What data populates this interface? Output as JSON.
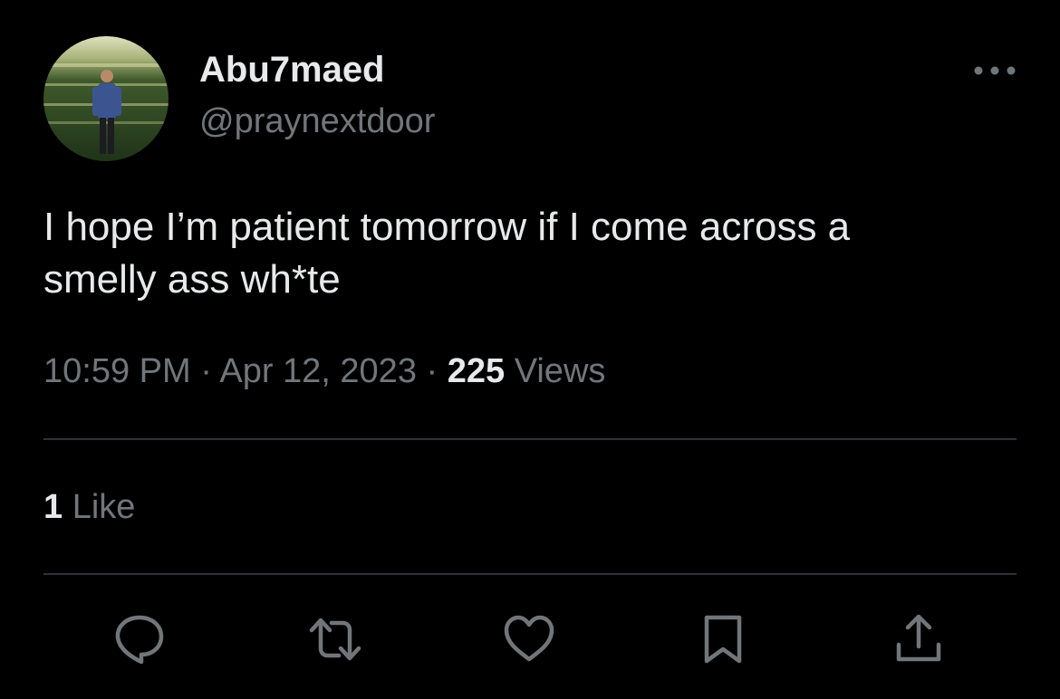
{
  "author": {
    "display_name": "Abu7maed",
    "handle": "@praynextdoor"
  },
  "tweet": {
    "text": "I hope I’m patient tomorrow if I come across a\nsmelly ass wh*te",
    "time": "10:59 PM",
    "separator": "·",
    "date": "Apr 12, 2023",
    "views_count": "225",
    "views_label": "Views"
  },
  "engagement": {
    "likes_count": "1",
    "likes_label": "Like"
  },
  "actions": [
    {
      "icon": "reply-icon"
    },
    {
      "icon": "retweet-icon"
    },
    {
      "icon": "heart-icon"
    },
    {
      "icon": "bookmark-icon"
    },
    {
      "icon": "share-icon"
    }
  ],
  "colors": {
    "background": "#000000",
    "text_primary": "#e7e9ea",
    "text_secondary": "#71767b",
    "divider": "#2f3336"
  }
}
